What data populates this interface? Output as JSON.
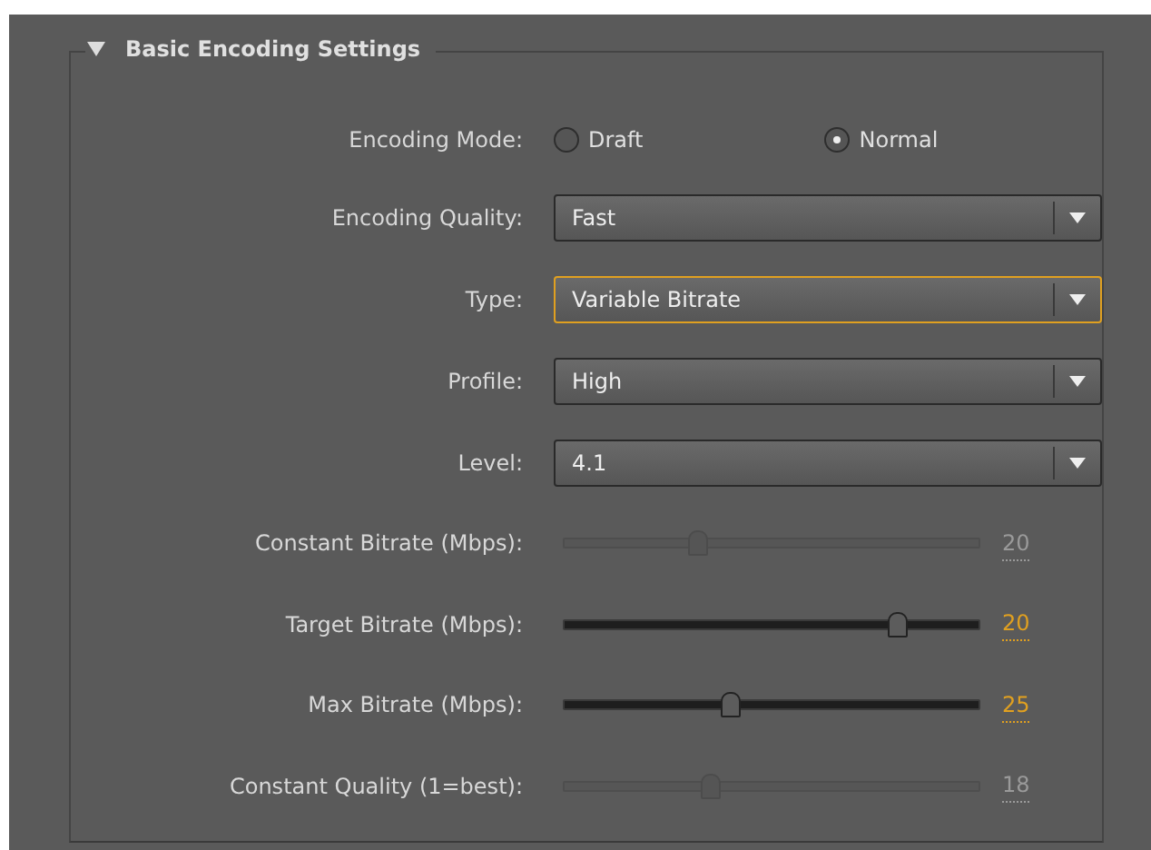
{
  "section": {
    "title": "Basic Encoding Settings",
    "expanded": true
  },
  "encoding_mode": {
    "label": "Encoding Mode:",
    "options": [
      {
        "label": "Draft",
        "selected": false
      },
      {
        "label": "Normal",
        "selected": true
      }
    ]
  },
  "dropdowns": [
    {
      "label": "Encoding Quality:",
      "value": "Fast",
      "focused": false
    },
    {
      "label": "Type:",
      "value": "Variable Bitrate",
      "focused": true
    },
    {
      "label": "Profile:",
      "value": "High",
      "focused": false
    },
    {
      "label": "Level:",
      "value": "4.1",
      "focused": false
    }
  ],
  "sliders": [
    {
      "label": "Constant Bitrate (Mbps):",
      "level": 0.32,
      "reading": "20",
      "disabled": true
    },
    {
      "label": "Target Bitrate (Mbps):",
      "level": 0.8,
      "reading": "20",
      "disabled": false
    },
    {
      "label": "Max Bitrate (Mbps):",
      "level": 0.4,
      "reading": "25",
      "disabled": false
    },
    {
      "label": "Constant Quality (1=best):",
      "level": 0.35,
      "reading": "18",
      "disabled": true
    }
  ]
}
